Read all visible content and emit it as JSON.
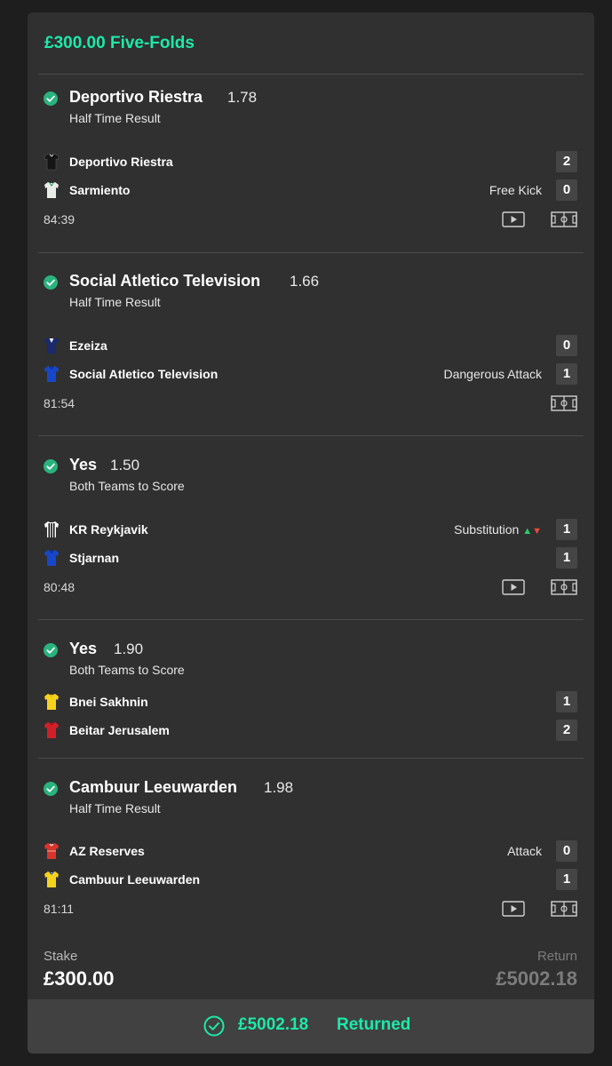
{
  "bet": {
    "title": "£300.00 Five-Folds"
  },
  "selections": [
    {
      "name": "Deportivo Riestra",
      "odds": "1.78",
      "market": "Half Time Result",
      "teams": [
        {
          "name": "Deportivo Riestra",
          "score": "2",
          "event": "",
          "kit_color": "#151515",
          "kit_trim": "#ffffff"
        },
        {
          "name": "Sarmiento",
          "score": "0",
          "event": "Free Kick",
          "kit_color": "#e8ece8",
          "kit_trim": "#1a9a4a"
        }
      ],
      "clock": "84:39",
      "icons": [
        "video-icon",
        "pitch-icon"
      ]
    },
    {
      "name": "Social Atletico Television",
      "odds": "1.66",
      "market": "Half Time Result",
      "teams": [
        {
          "name": "Ezeiza",
          "score": "0",
          "event": "",
          "kit_color": "#1a2a6c",
          "kit_trim": "#ffffff"
        },
        {
          "name": "Social Atletico Television",
          "score": "1",
          "event": "Dangerous Attack",
          "kit_color": "#1747c9",
          "kit_trim": "#0a2a8a"
        }
      ],
      "clock": "81:54",
      "icons": [
        "pitch-icon"
      ]
    },
    {
      "name": "Yes",
      "odds": "1.50",
      "market": "Both Teams to Score",
      "teams": [
        {
          "name": "KR Reykjavik",
          "score": "1",
          "event": "Substitution",
          "kit_color": "#ffffff",
          "kit_trim": "#111111"
        },
        {
          "name": "Stjarnan",
          "score": "1",
          "event": "",
          "kit_color": "#1747c9",
          "kit_trim": "#0a2a8a"
        }
      ],
      "clock": "80:48",
      "icons": [
        "video-icon",
        "pitch-icon"
      ]
    },
    {
      "name": "Yes",
      "odds": "1.90",
      "market": "Both Teams to Score",
      "teams": [
        {
          "name": "Bnei Sakhnin",
          "score": "1",
          "event": "",
          "kit_color": "#f5d21c",
          "kit_trim": "#d9b300"
        },
        {
          "name": "Beitar Jerusalem",
          "score": "2",
          "event": "",
          "kit_color": "#d0202a",
          "kit_trim": "#a01018"
        }
      ],
      "clock": "",
      "icons": []
    },
    {
      "name": "Cambuur Leeuwarden",
      "odds": "1.98",
      "market": "Half Time Result",
      "teams": [
        {
          "name": "AZ Reserves",
          "score": "0",
          "event": "Attack",
          "kit_color": "#d9342b",
          "kit_trim": "#ffffff"
        },
        {
          "name": "Cambuur Leeuwarden",
          "score": "1",
          "event": "",
          "kit_color": "#f5d21c",
          "kit_trim": "#1747c9"
        }
      ],
      "clock": "81:11",
      "icons": [
        "video-icon",
        "pitch-icon"
      ]
    }
  ],
  "summary": {
    "stake_label": "Stake",
    "stake_value": "£300.00",
    "return_label": "Return",
    "return_value": "£5002.18"
  },
  "returned": {
    "amount": "£5002.18",
    "label": "Returned"
  },
  "colors": {
    "accent": "#1de9a8",
    "check": "#29b37d",
    "card": "#2f302f"
  }
}
